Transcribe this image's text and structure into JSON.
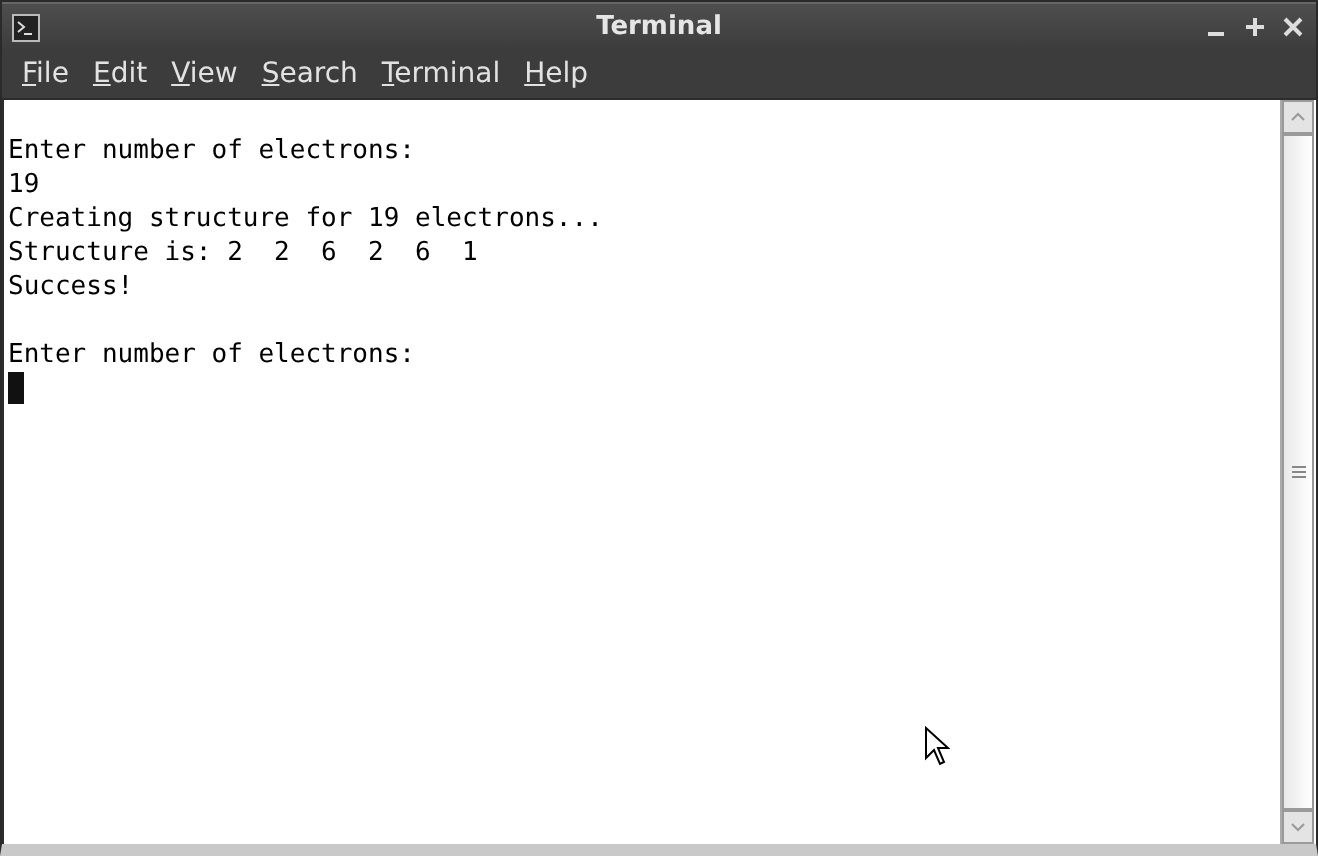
{
  "window": {
    "title": "Terminal"
  },
  "menu": [
    {
      "label": "File"
    },
    {
      "label": "Edit"
    },
    {
      "label": "View"
    },
    {
      "label": "Search"
    },
    {
      "label": "Terminal"
    },
    {
      "label": "Help"
    }
  ],
  "terminal": {
    "lines": [
      {
        "kind": "text",
        "text": "Enter number of electrons:"
      },
      {
        "kind": "text",
        "text": "19"
      },
      {
        "kind": "text",
        "text": "Creating structure for 19 electrons..."
      },
      {
        "kind": "text",
        "text": "Structure is: 2  2  6  2  6  1"
      },
      {
        "kind": "text",
        "text": "Success!"
      },
      {
        "kind": "blank"
      },
      {
        "kind": "text",
        "text": "Enter number of electrons:"
      },
      {
        "kind": "cursor"
      }
    ]
  }
}
